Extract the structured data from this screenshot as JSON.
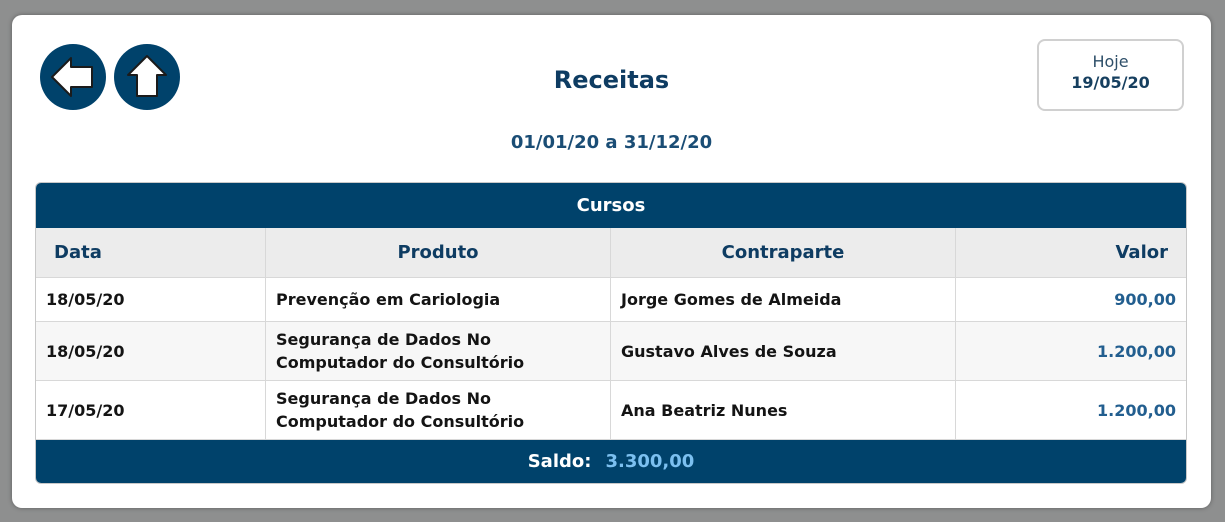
{
  "nav": {
    "back_icon": "arrow-left-icon",
    "up_icon": "arrow-up-icon",
    "icon_color": "#00426b"
  },
  "page": {
    "title": "Receitas",
    "period": "01/01/20 a 31/12/20"
  },
  "today": {
    "label": "Hoje",
    "date": "19/05/20"
  },
  "table": {
    "section_title": "Cursos",
    "columns": {
      "date": "Data",
      "product": "Produto",
      "counterpart": "Contraparte",
      "value": "Valor"
    },
    "rows": [
      {
        "date": "18/05/20",
        "product": "Prevenção em Cariologia",
        "counterpart": "Jorge Gomes de Almeida",
        "value": "900,00"
      },
      {
        "date": "18/05/20",
        "product": "Segurança de Dados No Computador do Consultório",
        "counterpart": "Gustavo Alves de Souza",
        "value": "1.200,00"
      },
      {
        "date": "17/05/20",
        "product": "Segurança de Dados No Computador do Consultório",
        "counterpart": "Ana Beatriz Nunes",
        "value": "1.200,00"
      }
    ],
    "footer": {
      "label": "Saldo:",
      "value": "3.300,00"
    }
  },
  "colors": {
    "brand": "#00426b",
    "value_text": "#225e8f",
    "saldo_value": "#7cc0f0"
  }
}
